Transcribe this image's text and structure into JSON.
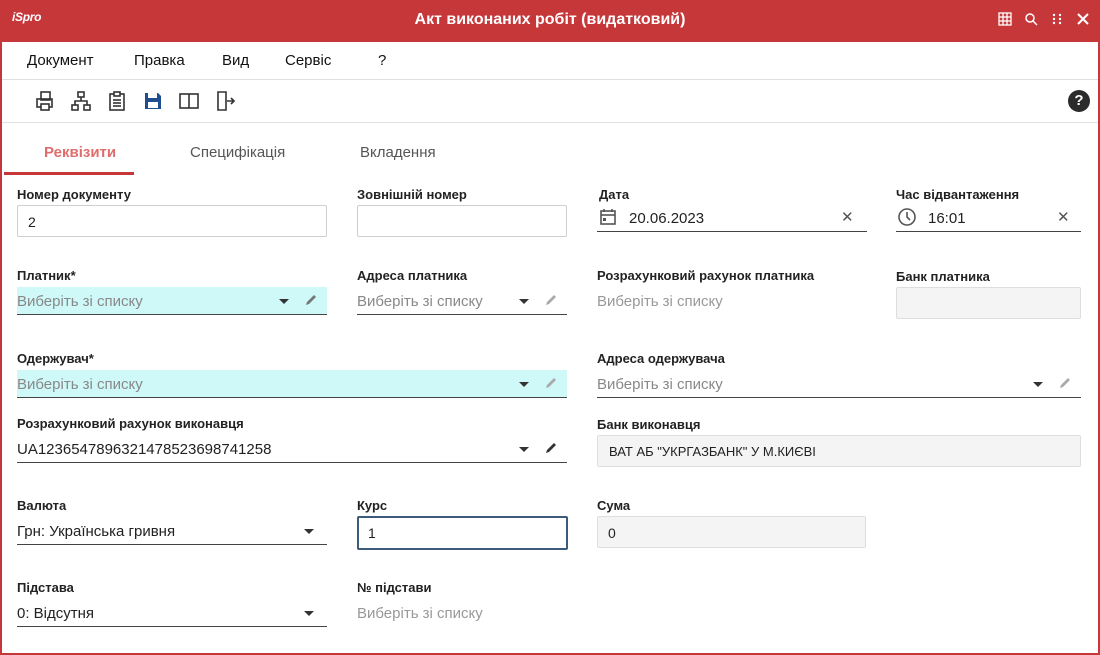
{
  "app": {
    "logo": "iSpro",
    "title": "Акт виконаних робіт (видатковий)"
  },
  "colors": {
    "accent": "#c6373a",
    "required_bg": "#cff8f8",
    "active_tab": "#e06c6c"
  },
  "window_controls": [
    "grid-icon",
    "search-icon",
    "more-icon",
    "close-icon"
  ],
  "menu": [
    "Документ",
    "Правка",
    "Вид",
    "Сервіс",
    "?"
  ],
  "toolbar": [
    "print-icon",
    "hierarchy-icon",
    "clipboard-icon",
    "save-icon",
    "book-icon",
    "exit-icon"
  ],
  "help_label": "?",
  "tabs": [
    {
      "label": "Реквізити",
      "active": true
    },
    {
      "label": "Специфікація",
      "active": false
    },
    {
      "label": "Вкладення",
      "active": false
    }
  ],
  "form": {
    "doc_number": {
      "label": "Номер документу",
      "value": "2"
    },
    "external_number": {
      "label": "Зовнішній номер",
      "value": ""
    },
    "date": {
      "label": "Дата",
      "value": "20.06.2023",
      "clear": "✕"
    },
    "ship_time": {
      "label": "Час відвантаження",
      "value": "16:01",
      "clear": "✕"
    },
    "payer": {
      "label": "Платник",
      "req": "*",
      "placeholder": "Виберіть зі списку"
    },
    "payer_address": {
      "label": "Адреса платника",
      "placeholder": "Виберіть зі списку"
    },
    "payer_account": {
      "label": "Розрахунковий рахунок платника",
      "placeholder": "Виберіть зі списку"
    },
    "payer_bank": {
      "label": "Банк платника",
      "value": ""
    },
    "recipient": {
      "label": "Одержувач",
      "req": "*",
      "placeholder": "Виберіть зі списку"
    },
    "recipient_address": {
      "label": "Адреса одержувача",
      "placeholder": "Виберіть зі списку"
    },
    "executor_account": {
      "label": "Розрахунковий рахунок виконавця",
      "value": "UA12365478963214785236987412​58"
    },
    "executor_bank": {
      "label": "Банк виконавця",
      "value": "ВАТ АБ \"УКРГАЗБАНК\" У М.КИЄВІ"
    },
    "currency": {
      "label": "Валюта",
      "value": "Грн: Українська гривня"
    },
    "rate": {
      "label": "Курс",
      "value": "1"
    },
    "sum": {
      "label": "Сума",
      "value": "0"
    },
    "basis": {
      "label": "Підстава",
      "value": "0: Відсутня"
    },
    "basis_number": {
      "label": "№ підстави",
      "placeholder": "Виберіть зі списку"
    }
  }
}
